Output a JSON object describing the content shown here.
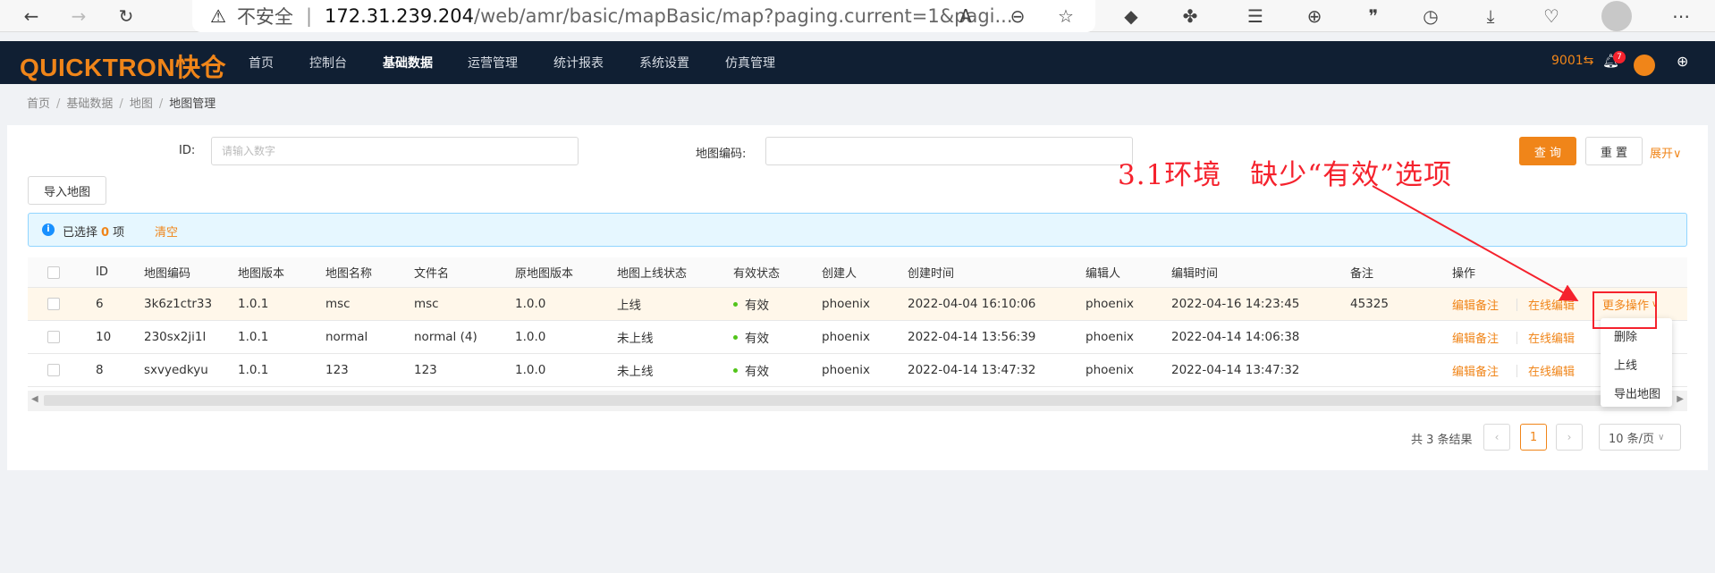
{
  "browser": {
    "insecure": "不安全",
    "separator": "|",
    "host": "172.31.239.204",
    "path": "/web/amr/basic/mapBasic/map?paging.current=1&pagi...",
    "icons": [
      "back-icon",
      "forward-icon",
      "refresh-icon",
      "warning-icon",
      "read-aloud-icon",
      "zoom-icon",
      "favorite-add-icon",
      "devtools-icon",
      "extensions-icon",
      "favorites-icon",
      "collections-icon",
      "quote-icon",
      "history-icon",
      "download-icon",
      "heartbeat-icon",
      "profile-icon",
      "more-icon"
    ]
  },
  "app": {
    "logo": "QUICKTRON快仓",
    "nav": [
      "首页",
      "控制台",
      "基础数据",
      "运营管理",
      "统计报表",
      "系统设置",
      "仿真管理"
    ],
    "active_nav": "基础数据",
    "warehouse": "9001",
    "warehouse_icon": "⇆",
    "notifications": "7"
  },
  "breadcrumb": [
    "首页",
    "基础数据",
    "地图",
    "地图管理"
  ],
  "filters": {
    "id_label": "ID:",
    "id_placeholder": "请输入数字",
    "code_label": "地图编码:",
    "code_value": "",
    "query": "查 询",
    "reset": "重 置",
    "expand": "展开"
  },
  "import_button": "导入地图",
  "selection": {
    "prefix": "已选择",
    "count": "0",
    "suffix": "项",
    "clear": "清空"
  },
  "table": {
    "columns": [
      "ID",
      "地图编码",
      "地图版本",
      "地图名称",
      "文件名",
      "原地图版本",
      "地图上线状态",
      "有效状态",
      "创建人",
      "创建时间",
      "编辑人",
      "编辑时间",
      "备注",
      "操作"
    ],
    "rows": [
      {
        "id": "6",
        "code": "3k6z1ctr33",
        "version": "1.0.1",
        "name": "msc",
        "file": "msc",
        "orig_version": "1.0.0",
        "online": "上线",
        "valid": "有效",
        "creator": "phoenix",
        "created": "2022-04-04 16:10:06",
        "editor": "phoenix",
        "edited": "2022-04-16 14:23:45",
        "remark": "45325"
      },
      {
        "id": "10",
        "code": "230sx2ji1l",
        "version": "1.0.1",
        "name": "normal",
        "file": "normal (4)",
        "orig_version": "1.0.0",
        "online": "未上线",
        "valid": "有效",
        "creator": "phoenix",
        "created": "2022-04-14 13:56:39",
        "editor": "phoenix",
        "edited": "2022-04-14 14:06:38",
        "remark": ""
      },
      {
        "id": "8",
        "code": "sxvyedkyu",
        "version": "1.0.1",
        "name": "123",
        "file": "123",
        "orig_version": "1.0.0",
        "online": "未上线",
        "valid": "有效",
        "creator": "phoenix",
        "created": "2022-04-14 13:47:32",
        "editor": "phoenix",
        "edited": "2022-04-14 13:47:32",
        "remark": ""
      }
    ],
    "actions": {
      "edit_remark": "编辑备注",
      "online_edit": "在线编辑",
      "more": "更多操作"
    }
  },
  "dropdown": [
    "删除",
    "上线",
    "导出地图"
  ],
  "pagination": {
    "total": "共 3 条结果",
    "current": "1",
    "page_size": "10 条/页"
  },
  "annotation": {
    "text": "3.1环境　缺少“有效”选项",
    "color": "#f5222d"
  },
  "colors": {
    "brand": "#f08519",
    "nav_bg": "#101f33",
    "valid_dot": "#52c41a",
    "info": "#1890ff"
  }
}
